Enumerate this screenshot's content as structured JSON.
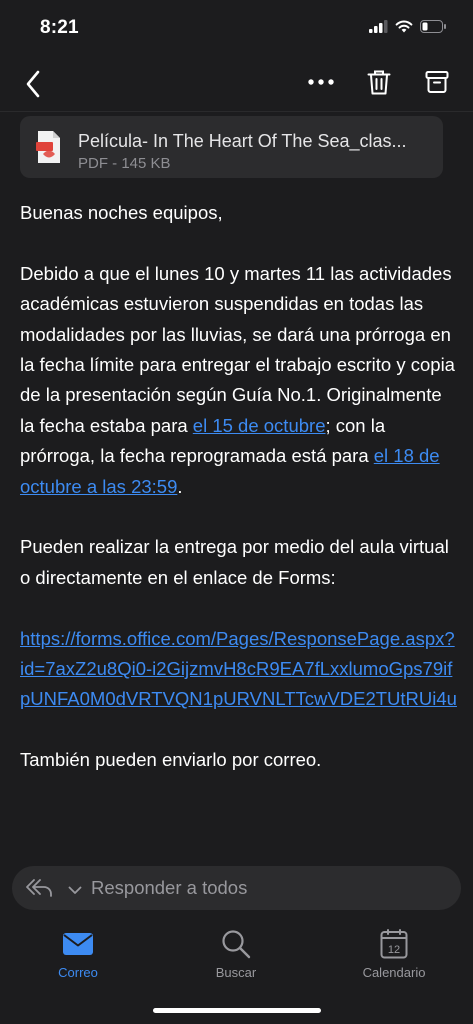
{
  "status": {
    "time": "8:21"
  },
  "nav": {
    "back_icon": "chevron-left-icon",
    "more_icon": "more-dots-icon",
    "delete_icon": "trash-icon",
    "archive_icon": "archive-icon"
  },
  "attachment": {
    "name": "Película- In The Heart Of The Sea_clas...",
    "meta": "PDF - 145 KB"
  },
  "email": {
    "greeting": "Buenas noches equipos,",
    "p1_before": "Debido a que el lunes 10 y martes 11 las actividades académicas estuvieron suspendidas en todas las modalidades por las lluvias, se dará una prórroga en la fecha límite para entregar el trabajo escrito y copia de la presentación según Guía No.1.  Originalmente la fecha estaba para ",
    "p1_link1": "el 15 de octubre",
    "p1_middle": "; con la prórroga, la fecha reprogramada está para ",
    "p1_link2": "el 18 de octubre a las 23:59",
    "p1_end": ".",
    "p2": "Pueden realizar la entrega por medio del aula virtual o directamente en el enlace de Forms:",
    "url": "https://forms.office.com/Pages/ResponsePage.aspx?id=7axZ2u8Qi0-i2GijzmvH8cR9EA7fLxxlumoGps79ifpUNFA0M0dVRTVQN1pURVNLTTcwVDE2TUtRUi4u",
    "p3": "También pueden enviarlo por correo."
  },
  "reply": {
    "label": "Responder a todos"
  },
  "tabs": [
    {
      "label": "Correo",
      "icon": "mail-icon",
      "active": true
    },
    {
      "label": "Buscar",
      "icon": "search-icon",
      "active": false
    },
    {
      "label": "Calendario",
      "icon": "calendar-icon",
      "active": false,
      "day": "12"
    }
  ],
  "colors": {
    "background": "#1c1c1e",
    "accent": "#3d8bf2",
    "card": "#2c2c2e",
    "muted": "#98989d"
  }
}
